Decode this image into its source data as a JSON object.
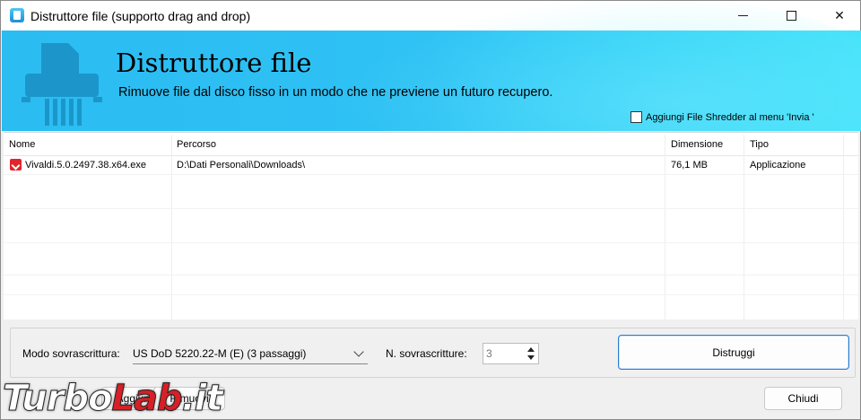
{
  "window": {
    "title": "Distruttore file (supporto drag and drop)"
  },
  "banner": {
    "title": "Distruttore file",
    "subtitle": "Rimuove file dal disco fisso in un modo che ne previene un futuro recupero.",
    "sendto_label": "Aggiungi File Shredder al menu 'Invia '",
    "sendto_checked": false
  },
  "list": {
    "columns": [
      "Nome",
      "Percorso",
      "Dimensione",
      "Tipo"
    ],
    "rows": [
      {
        "name": "Vivaldi.5.0.2497.38.x64.exe",
        "path": "D:\\Dati Personali\\Downloads\\",
        "size": "76,1 MB",
        "type": "Applicazione",
        "icon": "vivaldi-icon"
      }
    ]
  },
  "options": {
    "mode_label": "Modo sovrascrittura:",
    "mode_value": "US DoD 5220.22-M (E) (3 passaggi)",
    "passes_label": "N. sovrascritture:",
    "passes_value": "3",
    "destroy_button": "Distruggi"
  },
  "footer": {
    "left_button": "Aggiungi",
    "left_button_2": "Rimuovi",
    "close_button": "Chiudi"
  },
  "watermark": {
    "part1": "Turbo",
    "part2": "Lab",
    "part3": ".it"
  },
  "colors": {
    "banner_start": "#2bbcf2",
    "banner_end": "#45e3fa",
    "primary_border": "#2b7cd3",
    "watermark_red": "#d81f26"
  }
}
